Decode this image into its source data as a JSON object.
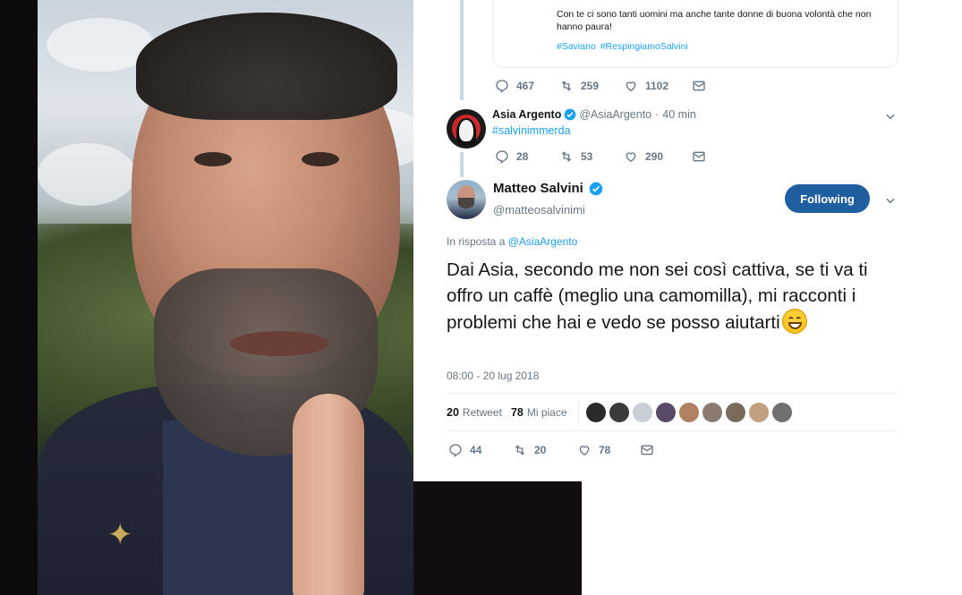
{
  "quoted_tweet": {
    "text": "Con te ci sono tanti uomini ma anche tante donne di buona volontà che non hanno paura!",
    "hashtags": [
      "#Saviano",
      "#RespingiamoSalvini"
    ],
    "replies": "467",
    "retweets": "259",
    "likes": "1102"
  },
  "reply_tweet": {
    "name": "Asia Argento",
    "handle": "@AsiaArgento",
    "separator": "·",
    "time": "40 min",
    "text": "#salvinimmerda",
    "replies": "28",
    "retweets": "53",
    "likes": "290"
  },
  "main_tweet": {
    "name": "Matteo Salvini",
    "handle": "@matteosalvinimi",
    "follow_label": "Following",
    "reply_prefix": "In risposta a",
    "reply_target": "@AsiaArgento",
    "text": "Dai Asia, secondo me non sei così cattiva, se ti va ti offro un caffè (meglio una camomilla), mi racconti i problemi che hai e vedo se posso aiutarti",
    "timestamp": "08:00 - 20 lug 2018",
    "retweet_count": "20",
    "retweet_label": "Retweet",
    "like_count": "78",
    "like_label": "Mi piace",
    "replies": "44",
    "retweets": "20",
    "likes": "78"
  },
  "colors": {
    "accent": "#1da1f2",
    "follow_button": "#1f5fa0",
    "muted": "#657786",
    "divider": "#e6ecf0"
  },
  "icons": [
    "reply-icon",
    "retweet-icon",
    "like-icon",
    "message-icon",
    "verified-icon",
    "chevron-down-icon",
    "grinning-emoji"
  ]
}
